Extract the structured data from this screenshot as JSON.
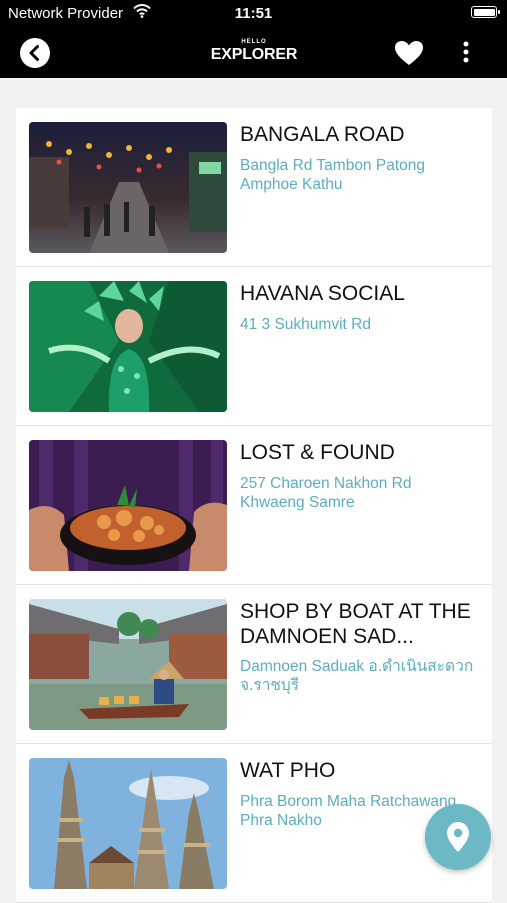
{
  "status_bar": {
    "carrier": "Network Provider",
    "time": "11:51"
  },
  "nav": {
    "logo_small": "HELLO",
    "logo": "EXPLORER"
  },
  "icons": {
    "back": "back-arrow-icon",
    "favorite": "heart-icon",
    "more": "more-vertical-icon",
    "map": "location-pin-icon",
    "wifi": "wifi-icon",
    "battery": "battery-icon"
  },
  "colors": {
    "accent": "#5aaec0",
    "fab": "#6cb8c4",
    "bar": "#000000"
  },
  "places": [
    {
      "title": "BANGALA ROAD",
      "address": "Bangla Rd Tambon Patong Amphoe Kathu"
    },
    {
      "title": "HAVANA SOCIAL",
      "address": "41 3 Sukhumvit Rd"
    },
    {
      "title": "LOST & FOUND",
      "address": "257 Charoen Nakhon Rd Khwaeng Samre"
    },
    {
      "title": "SHOP BY BOAT AT THE DAMNOEN SAD...",
      "address": "Damnoen Saduak อ.ดำเนินสะดวก จ.ราชบุรี"
    },
    {
      "title": "WAT PHO",
      "address": "Phra Borom Maha Ratchawang Phra Nakho"
    }
  ]
}
